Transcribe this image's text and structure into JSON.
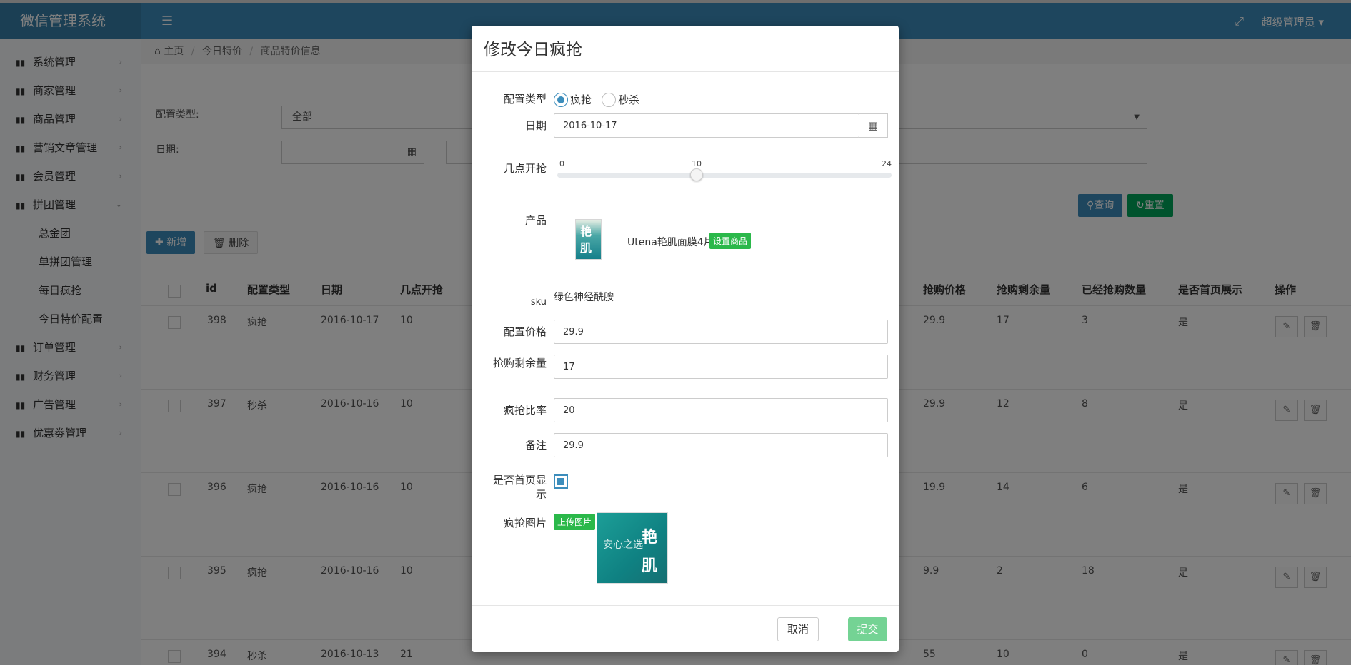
{
  "app": {
    "title": "微信管理系统",
    "user": "超级管理员"
  },
  "sidebar": {
    "items": [
      {
        "label": "系统管理"
      },
      {
        "label": "商家管理"
      },
      {
        "label": "商品管理"
      },
      {
        "label": "营销文章管理"
      },
      {
        "label": "会员管理"
      },
      {
        "label": "拼团管理"
      }
    ],
    "subitems": [
      {
        "label": "总金团"
      },
      {
        "label": "单拼团管理"
      },
      {
        "label": "每日疯抢"
      },
      {
        "label": "今日特价配置"
      }
    ],
    "items_after": [
      {
        "label": "订单管理"
      },
      {
        "label": "财务管理"
      },
      {
        "label": "广告管理"
      },
      {
        "label": "优惠劵管理"
      }
    ]
  },
  "breadcrumb": {
    "home": "主页",
    "level1": "今日特价",
    "level2": "商品特价信息"
  },
  "filters": {
    "type_label": "配置类型:",
    "type_value": "全部",
    "date_label": "日期:",
    "query_btn": "查询",
    "reset_btn": "重置"
  },
  "toolbar": {
    "add_btn": "新增",
    "delete_btn": "删除"
  },
  "table": {
    "headers": [
      "id",
      "配置类型",
      "日期",
      "几点开抢",
      "抢购价格",
      "抢购剩余量",
      "已经抢购数量",
      "是否首页展示",
      "操作"
    ],
    "rows": [
      {
        "id": "398",
        "type": "疯抢",
        "date": "2016-10-17",
        "hour": "10",
        "price": "29.9",
        "remain": "17",
        "sold": "3",
        "home": "是"
      },
      {
        "id": "397",
        "type": "秒杀",
        "date": "2016-10-16",
        "hour": "10",
        "price": "29.9",
        "remain": "12",
        "sold": "8",
        "home": "是"
      },
      {
        "id": "396",
        "type": "疯抢",
        "date": "2016-10-16",
        "hour": "10",
        "price": "19.9",
        "remain": "14",
        "sold": "6",
        "home": "是"
      },
      {
        "id": "395",
        "type": "疯抢",
        "date": "2016-10-16",
        "hour": "10",
        "price": "9.9",
        "remain": "2",
        "sold": "18",
        "home": "是"
      },
      {
        "id": "394",
        "type": "秒杀",
        "date": "2016-10-13",
        "hour": "21",
        "price": "55",
        "remain": "10",
        "sold": "0",
        "home": "是"
      }
    ]
  },
  "modal": {
    "title": "修改今日疯抢",
    "config_type_label": "配置类型",
    "radio_options": [
      "疯抢",
      "秒杀"
    ],
    "radio_selected": "疯抢",
    "date_label": "日期",
    "date_value": "2016-10-17",
    "start_hour_label": "几点开抢",
    "slider": {
      "min": "0",
      "value": "10",
      "max": "24",
      "min_n": 0,
      "value_n": 10,
      "max_n": 24
    },
    "product_label": "产品",
    "product_name": "Utena艳肌面膜4片",
    "set_product_btn": "设置商品",
    "sku_label": "sku",
    "sku_value": "绿色神经酰胺",
    "price_label": "配置价格",
    "price_value": "29.9",
    "remain_label": "抢购剩余量",
    "ratio_label": "疯抢比率",
    "ratio_value": "20",
    "remark_label": "备注",
    "remark_value": "29.9",
    "home_show_label": "是否首页显示",
    "home_show_checked": true,
    "image_label": "疯抢图片",
    "upload_btn": "上传图片",
    "cancel_btn": "取消",
    "submit_btn": "提交",
    "remain_value": "17"
  },
  "colors": {
    "topbar": "#3c8dbc",
    "accent_green": "#2bb84a",
    "submit_disabled": "#74d394"
  }
}
